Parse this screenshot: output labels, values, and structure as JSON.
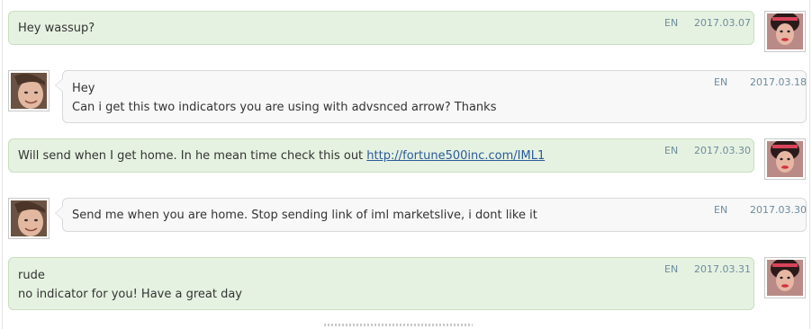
{
  "messages": [
    {
      "side": "right",
      "lines": [
        "Hey wassup?"
      ],
      "lang": "EN",
      "date": "2017.03.07",
      "avatar": "woman-avatar"
    },
    {
      "side": "left",
      "lines": [
        "Hey",
        "Can i get this two indicators you are using with advsnced arrow? Thanks"
      ],
      "lang": "EN",
      "date": "2017.03.18",
      "avatar": "man-avatar"
    },
    {
      "side": "right",
      "text_before_link": "Will send when I get home. In he mean time check this out ",
      "link": "http://fortune500inc.com/IML1",
      "lang": "EN",
      "date": "2017.03.30",
      "avatar": "woman-avatar"
    },
    {
      "side": "left",
      "lines": [
        "Send me when you are home. Stop sending link of iml marketslive, i dont like it"
      ],
      "lang": "EN",
      "date": "2017.03.30",
      "avatar": "man-avatar"
    },
    {
      "side": "right",
      "lines": [
        "rude",
        "no indicator for you! Have a great day"
      ],
      "lang": "EN",
      "date": "2017.03.31",
      "avatar": "woman-avatar"
    }
  ],
  "colors": {
    "right_bubble_bg": "#e6f2e1",
    "left_bubble_bg": "#f8f8f8",
    "meta_text": "#6d8c9e",
    "link": "#2a5a9a"
  }
}
